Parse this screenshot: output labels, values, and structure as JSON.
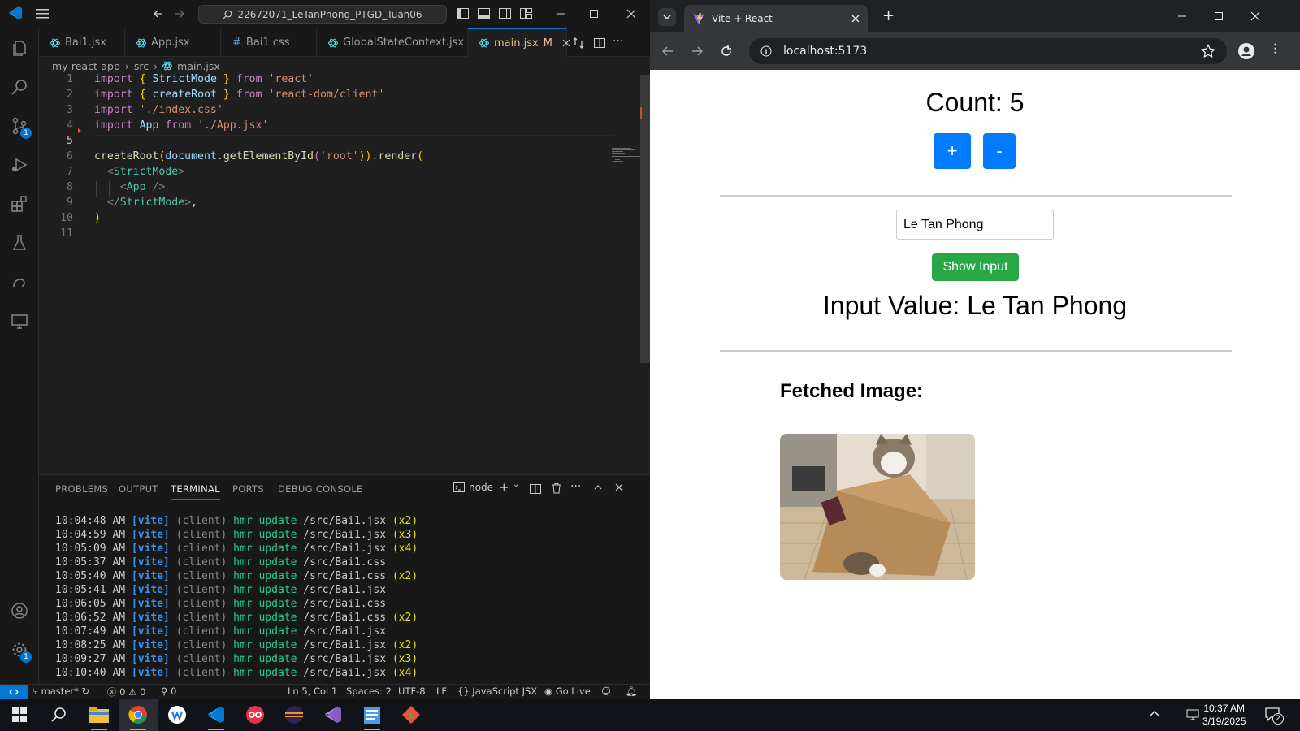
{
  "vscode": {
    "command_center": "22672071_LeTanPhong_PTGD_Tuan06",
    "tabs": [
      {
        "label": "Bai1.jsx",
        "icon": "react-icon"
      },
      {
        "label": "App.jsx",
        "icon": "react-icon"
      },
      {
        "label": "Bai1.css",
        "icon": "css-hash-icon"
      },
      {
        "label": "GlobalStateContext.jsx",
        "icon": "react-icon"
      },
      {
        "label": "main.jsx",
        "modified": "M",
        "icon": "react-icon"
      }
    ],
    "breadcrumb": [
      "my-react-app",
      "src",
      "main.jsx"
    ],
    "line_numbers": [
      "1",
      "2",
      "3",
      "4",
      "5",
      "6",
      "7",
      "8",
      "9",
      "10",
      "11"
    ],
    "code": {
      "l1": [
        "import",
        "{",
        "StrictMode",
        "}",
        "from",
        "'react'"
      ],
      "l2": [
        "import",
        "{",
        "createRoot",
        "}",
        "from",
        "'react-dom/client'"
      ],
      "l3": [
        "import",
        "'./index.css'"
      ],
      "l4": [
        "import",
        "App",
        "from",
        "'./App.jsx'"
      ],
      "l6": [
        "createRoot",
        "(",
        "document",
        ".",
        "getElementById",
        "(",
        "'root'",
        "))",
        ".",
        "render",
        "("
      ],
      "l7": [
        "<",
        "StrictMode",
        ">"
      ],
      "l8": [
        "<",
        "App",
        " />"
      ],
      "l9": [
        "</",
        "StrictMode",
        ">",
        ","
      ],
      "l10": [
        ")"
      ]
    },
    "activity_badges": {
      "source_control": "1",
      "settings": "1"
    },
    "panel_tabs": [
      "PROBLEMS",
      "OUTPUT",
      "TERMINAL",
      "PORTS",
      "DEBUG CONSOLE"
    ],
    "terminal_shell": "node",
    "terminal_lines": [
      {
        "time": "10:04:48 AM",
        "tag": "[vite]",
        "src": "(client)",
        "msg": "hmr update",
        "path": "/src/Bai1.jsx",
        "count": "(x2)"
      },
      {
        "time": "10:04:59 AM",
        "tag": "[vite]",
        "src": "(client)",
        "msg": "hmr update",
        "path": "/src/Bai1.jsx",
        "count": "(x3)"
      },
      {
        "time": "10:05:09 AM",
        "tag": "[vite]",
        "src": "(client)",
        "msg": "hmr update",
        "path": "/src/Bai1.jsx",
        "count": "(x4)"
      },
      {
        "time": "10:05:37 AM",
        "tag": "[vite]",
        "src": "(client)",
        "msg": "hmr update",
        "path": "/src/Bai1.css",
        "count": ""
      },
      {
        "time": "10:05:40 AM",
        "tag": "[vite]",
        "src": "(client)",
        "msg": "hmr update",
        "path": "/src/Bai1.css",
        "count": "(x2)"
      },
      {
        "time": "10:05:41 AM",
        "tag": "[vite]",
        "src": "(client)",
        "msg": "hmr update",
        "path": "/src/Bai1.jsx",
        "count": ""
      },
      {
        "time": "10:06:05 AM",
        "tag": "[vite]",
        "src": "(client)",
        "msg": "hmr update",
        "path": "/src/Bai1.css",
        "count": ""
      },
      {
        "time": "10:06:52 AM",
        "tag": "[vite]",
        "src": "(client)",
        "msg": "hmr update",
        "path": "/src/Bai1.css",
        "count": "(x2)"
      },
      {
        "time": "10:07:49 AM",
        "tag": "[vite]",
        "src": "(client)",
        "msg": "hmr update",
        "path": "/src/Bai1.jsx",
        "count": ""
      },
      {
        "time": "10:08:25 AM",
        "tag": "[vite]",
        "src": "(client)",
        "msg": "hmr update",
        "path": "/src/Bai1.jsx",
        "count": "(x2)"
      },
      {
        "time": "10:09:27 AM",
        "tag": "[vite]",
        "src": "(client)",
        "msg": "hmr update",
        "path": "/src/Bai1.jsx",
        "count": "(x3)"
      },
      {
        "time": "10:10:40 AM",
        "tag": "[vite]",
        "src": "(client)",
        "msg": "hmr update",
        "path": "/src/Bai1.jsx",
        "count": "(x4)"
      }
    ],
    "status": {
      "branch": "master*",
      "errors": "0",
      "warnings": "0",
      "ports": "0",
      "position": "Ln 5, Col 1",
      "spaces": "Spaces: 2",
      "encoding": "UTF-8",
      "eol": "LF",
      "language": "JavaScript JSX",
      "go_live": "Go Live"
    },
    "colors": {
      "accent": "#0078d4",
      "keyword": "#c586c0",
      "string": "#ce9178",
      "variable": "#9cdcfe"
    }
  },
  "chrome": {
    "tab_title": "Vite + React",
    "url": "localhost:5173",
    "page": {
      "count_text": "Count: 5",
      "plus_label": "+",
      "minus_label": "-",
      "input_value": "Le Tan Phong",
      "show_button": "Show Input",
      "input_value_text": "Input Value: Le Tan Phong",
      "fetched_heading": "Fetched Image:"
    },
    "colors": {
      "primary_button": "#007bff",
      "success_button": "#28a745"
    }
  },
  "taskbar": {
    "time": "10:37 AM",
    "date": "3/19/2025",
    "notification_count": "2"
  }
}
